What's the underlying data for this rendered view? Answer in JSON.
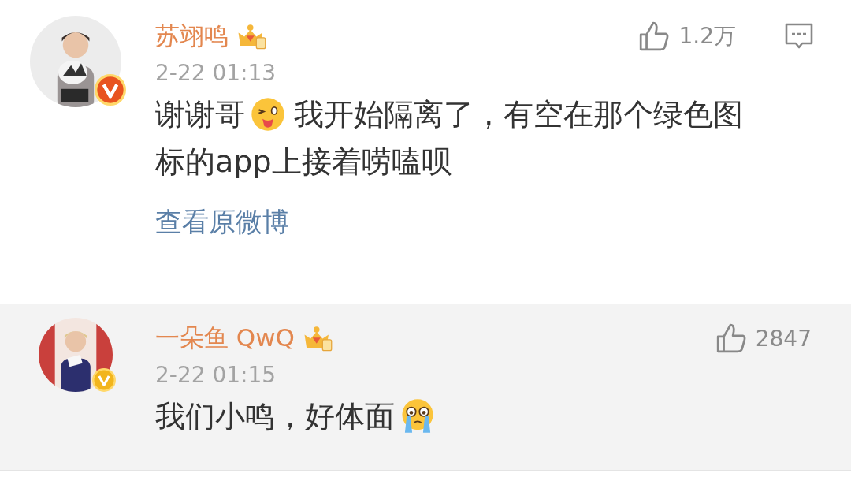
{
  "comments": [
    {
      "name": "苏翊鸣",
      "crown": true,
      "verified": {
        "color": "#e8531f"
      },
      "likes": "1.2万",
      "reply_icon": true,
      "time": "2-22 01:13",
      "highlighted": false,
      "content": [
        {
          "kind": "text",
          "text": "谢谢哥"
        },
        {
          "kind": "wink"
        },
        {
          "kind": "text",
          "text": "我开始隔离了，有空在那个绿色图"
        },
        {
          "kind": "text",
          "text": "标的app上接着唠嗑呗"
        }
      ],
      "link": "查看原微博"
    },
    {
      "name": "一朵鱼 QwQ",
      "crown": true,
      "verified": {
        "color": "#f2b51c"
      },
      "likes": "2847",
      "reply_icon": false,
      "time": "2-22 01:15",
      "highlighted": true,
      "content": [
        {
          "kind": "text",
          "text": "我们小鸣，好体面"
        },
        {
          "kind": "cry"
        }
      ]
    }
  ]
}
